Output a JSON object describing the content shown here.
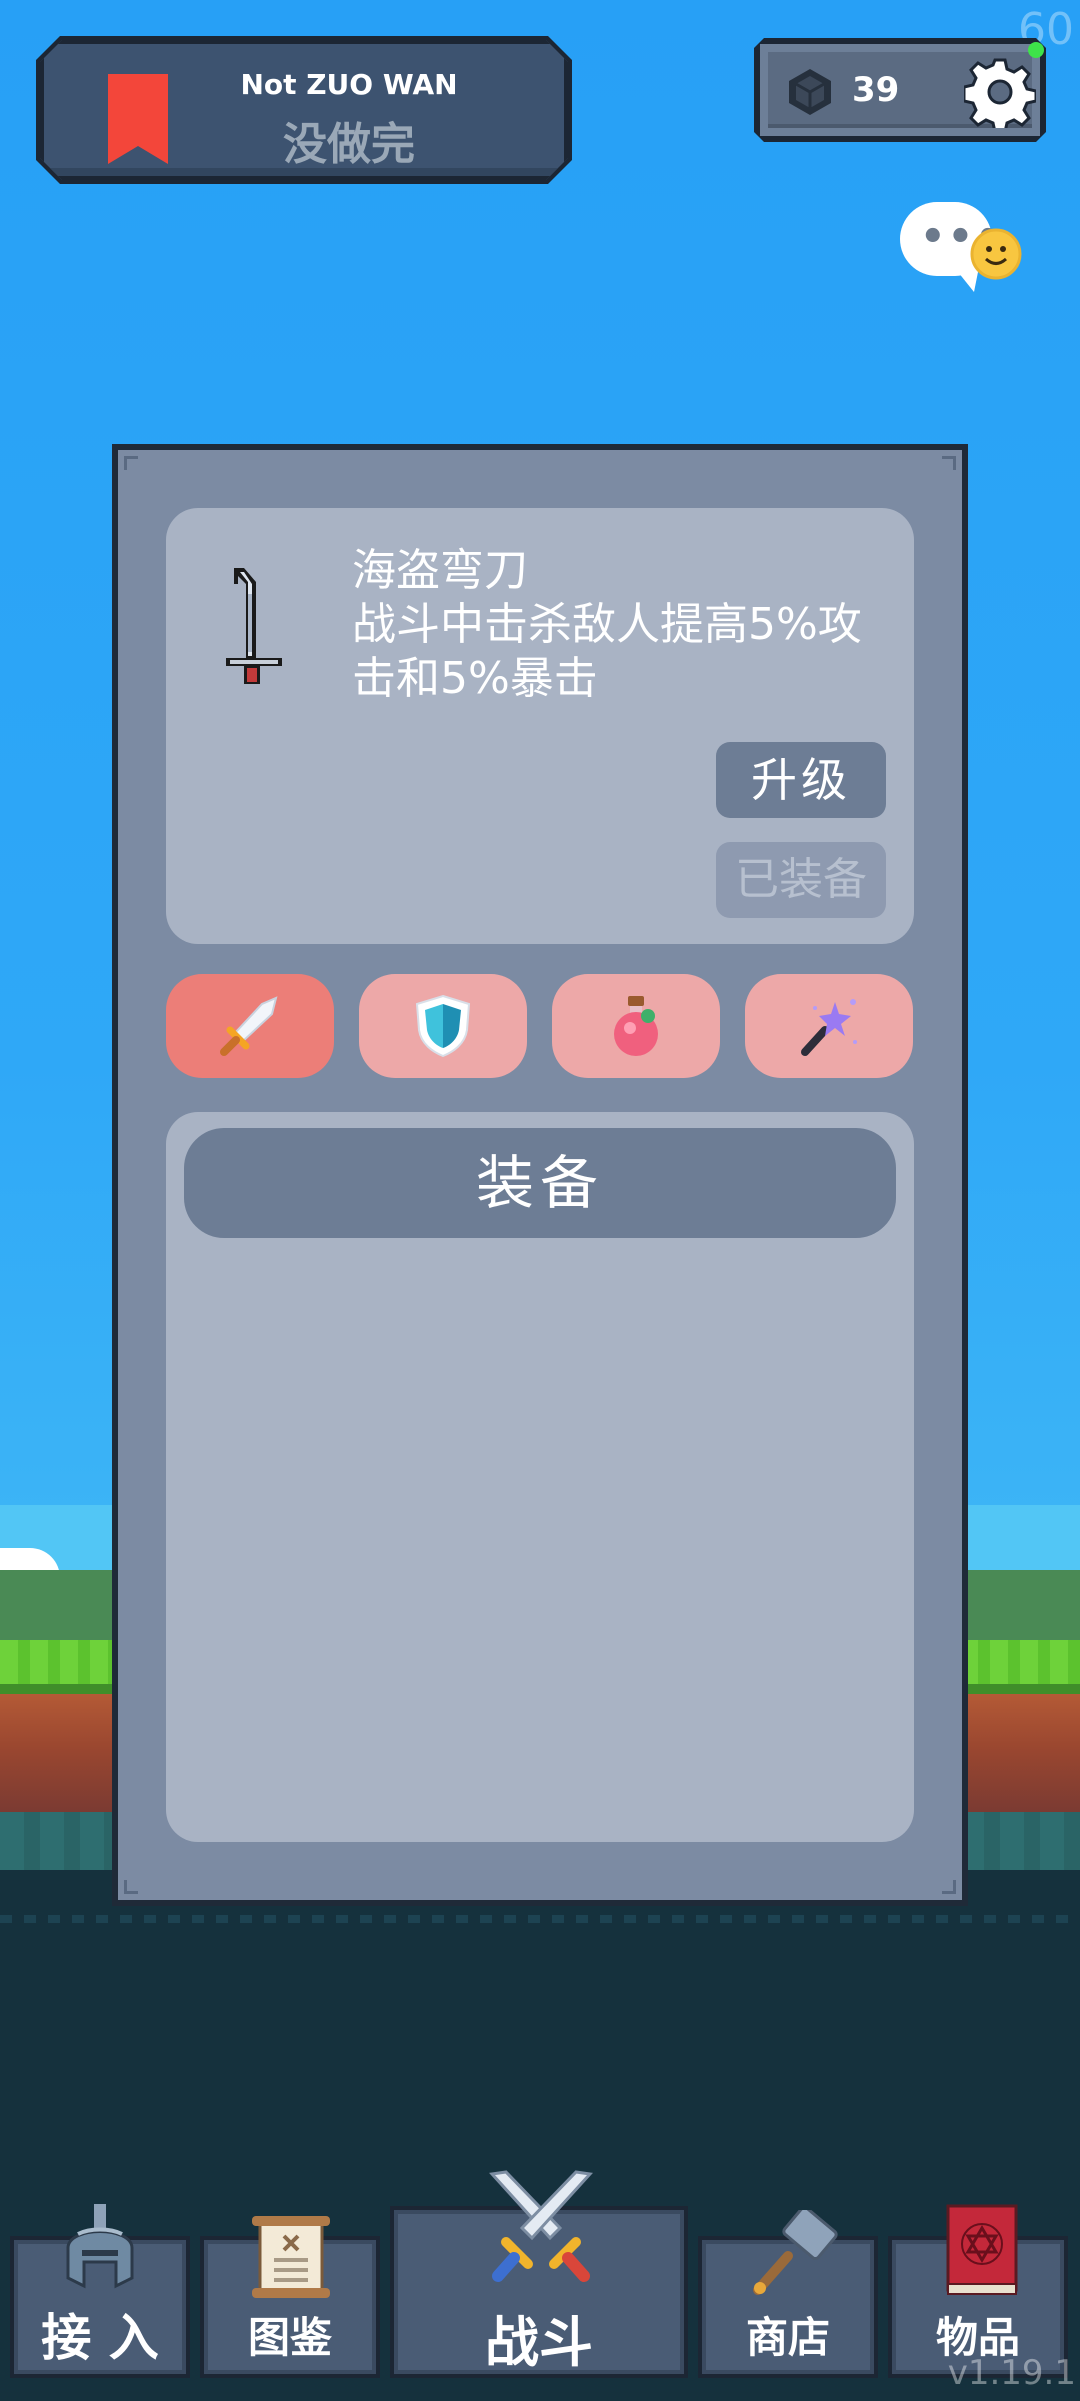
{
  "hud": {
    "fps": "60",
    "version": "v1.19.1"
  },
  "quest": {
    "title": "Not ZUO WAN",
    "subtitle": "没做完",
    "bookmark_icon": "bookmark-icon",
    "bookmark_color": "#f3463a"
  },
  "currency": {
    "icon": "gem-icon",
    "count": "39",
    "settings_icon": "gear-icon"
  },
  "chat": {
    "dots": "•••",
    "icon": "chat-bubble-icon"
  },
  "item": {
    "name": "海盗弯刀",
    "description": "战斗中击杀敌人提高5%攻击和5%暴击",
    "icon": "cutlass-icon",
    "upgrade_label": "升级",
    "equipped_label": "已装备"
  },
  "categories": [
    {
      "icon": "sword-icon",
      "active": true
    },
    {
      "icon": "shield-icon",
      "active": false
    },
    {
      "icon": "potion-icon",
      "active": false
    },
    {
      "icon": "magic-wand-icon",
      "active": false
    }
  ],
  "list": {
    "header": "装备"
  },
  "nav": [
    {
      "label": "接 入",
      "icon": "helmet-icon"
    },
    {
      "label": "图鉴",
      "icon": "scroll-icon"
    },
    {
      "label": "战斗",
      "icon": "crossed-swords-icon"
    },
    {
      "label": "商店",
      "icon": "hammer-icon"
    },
    {
      "label": "物品",
      "icon": "spellbook-icon"
    }
  ],
  "colors": {
    "sky": "#2a9ef5",
    "panel": "#7c8ba3",
    "card": "#a9b3c4",
    "button": "#6d7d95",
    "category_active": "#ec7e78",
    "category": "#eda8a8"
  }
}
